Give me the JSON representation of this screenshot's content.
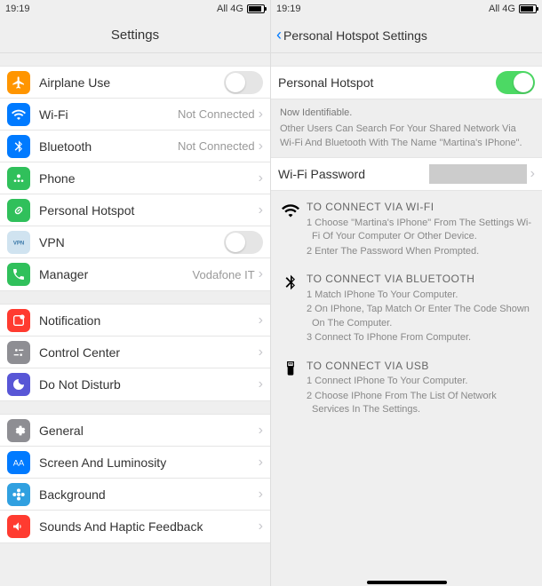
{
  "status": {
    "time": "19:19",
    "net": "All 4G"
  },
  "left": {
    "title": "Settings",
    "g1": [
      {
        "name": "airplane-use",
        "label": "Airplane Use",
        "value": "",
        "chev": false,
        "toggle": true,
        "toggleOn": false,
        "bg": "#ff9500",
        "icon": "airplane"
      },
      {
        "name": "wifi",
        "label": "Wi-Fi",
        "value": "Not Connected",
        "chev": true,
        "bg": "#007aff",
        "icon": "wifi"
      },
      {
        "name": "bluetooth",
        "label": "Bluetooth",
        "value": "Not Connected",
        "chev": true,
        "bg": "#007aff",
        "icon": "bluetooth"
      },
      {
        "name": "phone",
        "label": "Phone",
        "value": "",
        "chev": true,
        "bg": "#30c05b",
        "icon": "phone"
      },
      {
        "name": "personal-hotspot",
        "label": "Personal Hotspot",
        "value": "",
        "chev": true,
        "bg": "#30c05b",
        "icon": "link"
      },
      {
        "name": "vpn",
        "label": "VPN",
        "value": "",
        "chev": false,
        "toggle": true,
        "toggleOn": false,
        "bg": "#d0e3f0",
        "icon": "vpn"
      },
      {
        "name": "manager",
        "label": "Manager",
        "value": "Vodafone IT",
        "chev": true,
        "bg": "#30c05b",
        "icon": "call"
      }
    ],
    "g2": [
      {
        "name": "notification",
        "label": "Notification",
        "chev": true,
        "bg": "#ff3b30",
        "icon": "notif"
      },
      {
        "name": "control-center",
        "label": "Control Center",
        "chev": true,
        "bg": "#8e8e93",
        "icon": "cc"
      },
      {
        "name": "do-not-disturb",
        "label": "Do Not Disturb",
        "chev": true,
        "bg": "#5856d6",
        "icon": "moon"
      }
    ],
    "g3": [
      {
        "name": "general",
        "label": "General",
        "chev": true,
        "bg": "#8e8e93",
        "icon": "gear"
      },
      {
        "name": "screen-luminosity",
        "label": "Screen And Luminosity",
        "chev": true,
        "bg": "#007aff",
        "icon": "aa"
      },
      {
        "name": "background",
        "label": "Background",
        "chev": true,
        "bg": "#30a0e0",
        "icon": "flower"
      },
      {
        "name": "sounds-haptic",
        "label": "Sounds And Haptic Feedback",
        "chev": true,
        "bg": "#ff3b30",
        "icon": "sound"
      }
    ]
  },
  "right": {
    "title": "Personal Hotspot Settings",
    "toggleLabel": "Personal Hotspot",
    "toggleOn": true,
    "infoTitle": "Now Identifiable.",
    "infoBody": "Other Users Can Search For Your Shared Network Via Wi-Fi And Bluetooth With The Name \"Martina's IPhone\".",
    "pwLabel": "Wi-Fi Password",
    "instructs": [
      {
        "icon": "wifi",
        "title": "TO CONNECT VIA WI-FI",
        "steps": [
          "1 Choose \"Martina's IPhone\" From The Settings Wi-Fi Of Your Computer Or Other Device.",
          "2 Enter The Password When Prompted."
        ]
      },
      {
        "icon": "bluetooth",
        "title": "TO CONNECT VIA BLUETOOTH",
        "steps": [
          "1 Match IPhone To Your Computer.",
          "2 On IPhone, Tap Match Or Enter The Code Shown On The Computer.",
          "3 Connect To IPhone From Computer."
        ]
      },
      {
        "icon": "usb",
        "title": "TO CONNECT VIA USB",
        "steps": [
          "1 Connect IPhone To Your Computer.",
          "2 Choose IPhone From The List Of Network Services In The Settings."
        ]
      }
    ]
  }
}
